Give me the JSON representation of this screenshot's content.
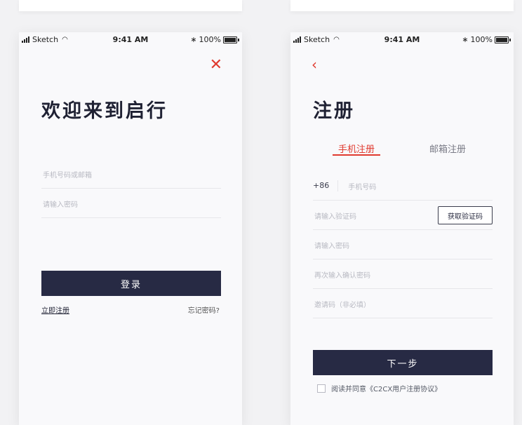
{
  "status_bar": {
    "carrier": "Sketch",
    "time": "9:41 AM",
    "battery_pct": "100%"
  },
  "login": {
    "title": "欢迎来到启行",
    "account_placeholder": "手机号码或邮箱",
    "password_placeholder": "请输入密码",
    "login_button": "登录",
    "register_link": "立即注册",
    "forgot_link": "忘记密码?"
  },
  "register": {
    "title": "注册",
    "tabs": [
      {
        "label": "手机注册",
        "active": true
      },
      {
        "label": "邮箱注册",
        "active": false
      }
    ],
    "country_code": "+86",
    "phone_placeholder": "手机号码",
    "code_placeholder": "请输入验证码",
    "get_code_button": "获取验证码",
    "password_placeholder": "请输入密码",
    "confirm_password_placeholder": "再次输入确认密码",
    "invite_placeholder": "邀请码（非必填）",
    "next_button": "下一步",
    "agreement_text": "阅读并同意《C2CX用户注册协议》"
  },
  "colors": {
    "accent": "#e03a2f",
    "primary": "#272a44",
    "background": "#f9f9fb"
  }
}
